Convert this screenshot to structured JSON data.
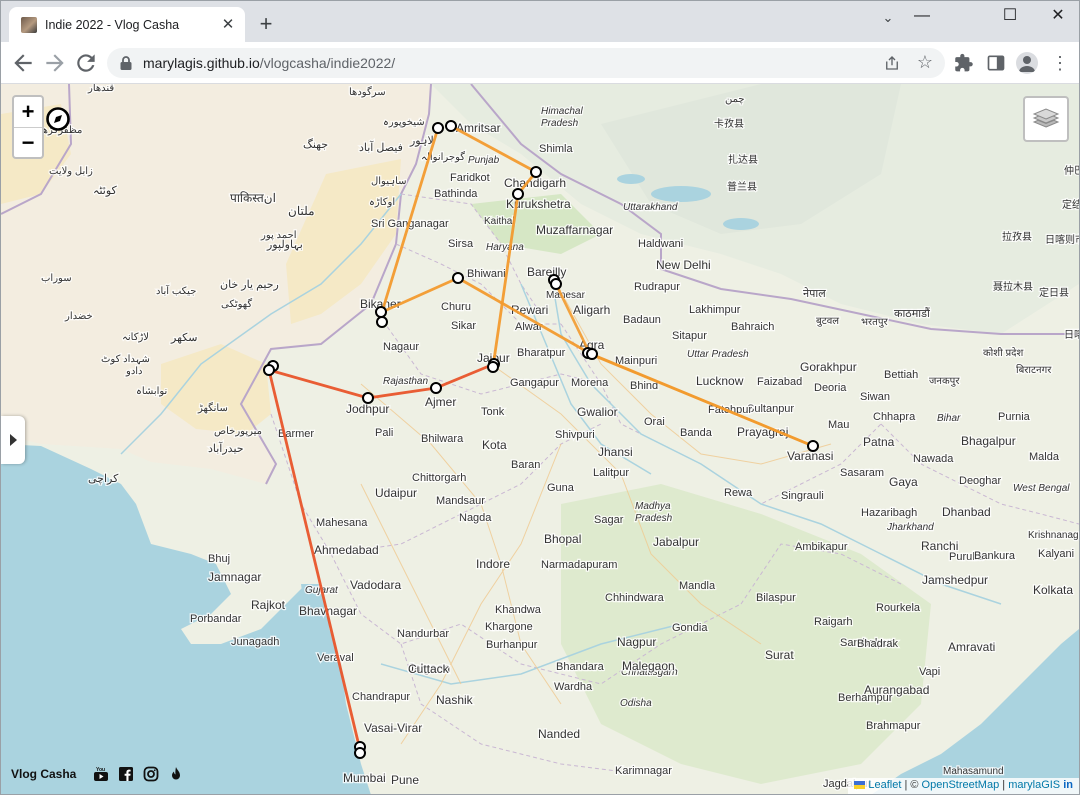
{
  "browser": {
    "tab_title": "Indie 2022 - Vlog Casha",
    "new_tab": "+",
    "close_tab": "✕",
    "win_min": "—",
    "win_max": "☐",
    "win_close": "✕",
    "url_host": "marylagis.github.io",
    "url_path": "/vlogcasha/indie2022/"
  },
  "map": {
    "zoom_in": "+",
    "zoom_out": "−",
    "brand": "Vlog Casha",
    "attribution": {
      "leaflet": "Leaflet",
      "sep1": " | © ",
      "osm": "OpenStreetMap",
      "sep2": " | ",
      "author": "marylaGIS",
      "in": "in"
    },
    "colors": {
      "route_orange": "#f29a2e",
      "route_red": "#e8542a",
      "water": "#aad3df",
      "land": "#eef0e4",
      "desert": "#f5e9c6",
      "forest": "#d6e7c5"
    },
    "labels": [
      {
        "text": "Amritsar",
        "size": 12
      },
      {
        "text": "Shimla",
        "size": 11
      },
      {
        "text": "Chandigarh",
        "size": 12
      },
      {
        "text": "Punjab",
        "size": 10,
        "italic": true
      },
      {
        "text": "Faridkot",
        "size": 11
      },
      {
        "text": "Bathinda",
        "size": 11
      },
      {
        "text": "Kurukshetra",
        "size": 12
      },
      {
        "text": "Kaithal",
        "size": 10
      },
      {
        "text": "Himachal",
        "size": 10,
        "italic": true
      },
      {
        "text": "Pradesh",
        "size": 10,
        "italic": true
      },
      {
        "text": "Uttarakhand",
        "size": 10,
        "italic": true
      },
      {
        "text": "Muzaffarnagar",
        "size": 12
      },
      {
        "text": "Sri Ganganagar",
        "size": 11
      },
      {
        "text": "Sirsa",
        "size": 11
      },
      {
        "text": "Haryana",
        "size": 10,
        "italic": true
      },
      {
        "text": "Haldwani",
        "size": 11
      },
      {
        "text": "Bhiwani",
        "size": 11
      },
      {
        "text": "New Delhi",
        "size": 12
      },
      {
        "text": "Rudrapur",
        "size": 11
      },
      {
        "text": "Bareilly",
        "size": 12
      },
      {
        "text": "Manesar",
        "size": 10
      },
      {
        "text": "Rewari",
        "size": 12
      },
      {
        "text": "Aligarh",
        "size": 12
      },
      {
        "text": "Lakhimpur",
        "size": 11
      },
      {
        "text": "Bikaner",
        "size": 12
      },
      {
        "text": "Churu",
        "size": 11
      },
      {
        "text": "Sikar",
        "size": 11
      },
      {
        "text": "Alwar",
        "size": 11
      },
      {
        "text": "Badaun",
        "size": 11
      },
      {
        "text": "Bahraich",
        "size": 11
      },
      {
        "text": "Sitapur",
        "size": 11
      },
      {
        "text": "Nagaur",
        "size": 11
      },
      {
        "text": "Jaipur",
        "size": 12
      },
      {
        "text": "Bharatpur",
        "size": 11
      },
      {
        "text": "Agra",
        "size": 12
      },
      {
        "text": "Mainpuri",
        "size": 11
      },
      {
        "text": "Uttar Pradesh",
        "size": 10,
        "italic": true
      },
      {
        "text": "Lucknow",
        "size": 12
      },
      {
        "text": "Faizabad",
        "size": 11
      },
      {
        "text": "Gorakhpur",
        "size": 12
      },
      {
        "text": "Rajasthan",
        "size": 10,
        "italic": true
      },
      {
        "text": "Gangapur",
        "size": 11
      },
      {
        "text": "Morena",
        "size": 11
      },
      {
        "text": "Bhind",
        "size": 11
      },
      {
        "text": "Jodhpur",
        "size": 12
      },
      {
        "text": "Ajmer",
        "size": 12
      },
      {
        "text": "Tonk",
        "size": 11
      },
      {
        "text": "Gwalior",
        "size": 12
      },
      {
        "text": "Sultanpur",
        "size": 11
      },
      {
        "text": "Fatehpur",
        "size": 11
      },
      {
        "text": "Prayagraj",
        "size": 12
      },
      {
        "text": "Mau",
        "size": 11
      },
      {
        "text": "Varanasi",
        "size": 12
      },
      {
        "text": "Deoria",
        "size": 11
      },
      {
        "text": "Siwan",
        "size": 11
      },
      {
        "text": "Bettiah",
        "size": 11
      },
      {
        "text": "Chhapra",
        "size": 11
      },
      {
        "text": "Patna",
        "size": 12
      },
      {
        "text": "Bhagalpur",
        "size": 12
      },
      {
        "text": "Purnia",
        "size": 11
      },
      {
        "text": "Bihar",
        "size": 10,
        "italic": true
      },
      {
        "text": "Barmer",
        "size": 11
      },
      {
        "text": "Pali",
        "size": 11
      },
      {
        "text": "Bhilwara",
        "size": 11
      },
      {
        "text": "Kota",
        "size": 12
      },
      {
        "text": "Shivpuri",
        "size": 11
      },
      {
        "text": "Orai",
        "size": 11
      },
      {
        "text": "Banda",
        "size": 11
      },
      {
        "text": "Jhansi",
        "size": 12
      },
      {
        "text": "Baran",
        "size": 11
      },
      {
        "text": "Lalitpur",
        "size": 11
      },
      {
        "text": "Sasaram",
        "size": 11
      },
      {
        "text": "Gaya",
        "size": 12
      },
      {
        "text": "Nawada",
        "size": 11
      },
      {
        "text": "Deoghar",
        "size": 11
      },
      {
        "text": "West Bengal",
        "size": 10,
        "italic": true
      },
      {
        "text": "Malda",
        "size": 11
      },
      {
        "text": "Chittorgarh",
        "size": 11
      },
      {
        "text": "Udaipur",
        "size": 12
      },
      {
        "text": "Mandsaur",
        "size": 11
      },
      {
        "text": "Guna",
        "size": 11
      },
      {
        "text": "Rewa",
        "size": 11
      },
      {
        "text": "Singrauli",
        "size": 11
      },
      {
        "text": "Madhya",
        "size": 10,
        "italic": true
      },
      {
        "text": "Pradesh",
        "size": 10,
        "italic": true
      },
      {
        "text": "Sagar",
        "size": 11
      },
      {
        "text": "Hazaribagh",
        "size": 11
      },
      {
        "text": "Jharkhand",
        "size": 10,
        "italic": true
      },
      {
        "text": "Dhanbad",
        "size": 12
      },
      {
        "text": "Krishnanagar",
        "size": 10
      },
      {
        "text": "Mahesana",
        "size": 11
      },
      {
        "text": "Ahmedabad",
        "size": 12
      },
      {
        "text": "Nagda",
        "size": 11
      },
      {
        "text": "Bhopal",
        "size": 12
      },
      {
        "text": "Jabalpur",
        "size": 12
      },
      {
        "text": "Ambikapur",
        "size": 11
      },
      {
        "text": "Ranchi",
        "size": 12
      },
      {
        "text": "Purulia",
        "size": 11
      },
      {
        "text": "Bankura",
        "size": 11
      },
      {
        "text": "Kalyani",
        "size": 11
      },
      {
        "text": "Bhuj",
        "size": 11
      },
      {
        "text": "Jamnagar",
        "size": 12
      },
      {
        "text": "Vadodara",
        "size": 12
      },
      {
        "text": "Indore",
        "size": 12
      },
      {
        "text": "Narmadapuram",
        "size": 11
      },
      {
        "text": "Mandla",
        "size": 11
      },
      {
        "text": "Jamshedpur",
        "size": 12
      },
      {
        "text": "Kolkata",
        "size": 12
      },
      {
        "text": "Rajkot",
        "size": 12
      },
      {
        "text": "Bhavnagar",
        "size": 12
      },
      {
        "text": "Chhindwara",
        "size": 11
      },
      {
        "text": "Bilaspur",
        "size": 11
      },
      {
        "text": "Rourkela",
        "size": 11
      },
      {
        "text": "Porbandar",
        "size": 11
      },
      {
        "text": "Gujarat",
        "size": 10,
        "italic": true
      },
      {
        "text": "Khandwa",
        "size": 11
      },
      {
        "text": "Khargone",
        "size": 11
      },
      {
        "text": "Gondia",
        "size": 11
      },
      {
        "text": "Junagadh",
        "size": 11
      },
      {
        "text": "Nandurbar",
        "size": 11
      },
      {
        "text": "Burhanpur",
        "size": 11
      },
      {
        "text": "Nagpur",
        "size": 12
      },
      {
        "text": "Raigarh",
        "size": 11
      },
      {
        "text": "Jalgaon",
        "size": 12
      },
      {
        "text": "Sambalpur",
        "size": 11
      },
      {
        "text": "Veraval",
        "size": 11
      },
      {
        "text": "Surat",
        "size": 12
      },
      {
        "text": "Bhandara",
        "size": 11
      },
      {
        "text": "Chhattisgarh",
        "size": 10,
        "italic": true
      },
      {
        "text": "Bhadrak",
        "size": 11
      },
      {
        "text": "Amravati",
        "size": 12
      },
      {
        "text": "Wardha",
        "size": 11
      },
      {
        "text": "Malegaon",
        "size": 12
      },
      {
        "text": "Cuttack",
        "size": 12
      },
      {
        "text": "Vapi",
        "size": 11
      },
      {
        "text": "Chandrapur",
        "size": 11
      },
      {
        "text": "Odisha",
        "size": 10,
        "italic": true
      },
      {
        "text": "Aurangabad",
        "size": 12
      },
      {
        "text": "Nashik",
        "size": 12
      },
      {
        "text": "Berhampur",
        "size": 11
      },
      {
        "text": "Brahmapur",
        "size": 11
      },
      {
        "text": "Vasai-Virar",
        "size": 12
      },
      {
        "text": "Nanded",
        "size": 12
      },
      {
        "text": "Mumbai",
        "size": 12
      },
      {
        "text": "Karimnagar",
        "size": 11
      },
      {
        "text": "Pune",
        "size": 12
      },
      {
        "text": "Jagdalpur",
        "size": 11
      },
      {
        "text": "Mahasamund",
        "size": 10
      },
      {
        "text": "नेपाल",
        "size": 11
      },
      {
        "text": "काठमाडौं",
        "size": 11
      },
      {
        "text": "बुटवल",
        "size": 10
      },
      {
        "text": "भरतपुर",
        "size": 10
      },
      {
        "text": "कोशी प्रदेश",
        "size": 10
      },
      {
        "text": "बिराटनगर",
        "size": 10
      },
      {
        "text": "जनकपुर",
        "size": 10
      },
      {
        "text": "पाकिस्तان",
        "size": 12
      },
      {
        "text": "ملتان",
        "size": 12
      },
      {
        "text": "لاہور",
        "size": 11
      },
      {
        "text": "گوجرانوالہ",
        "size": 10
      },
      {
        "text": "فیصل آباد",
        "size": 11
      },
      {
        "text": "جھنگ",
        "size": 11
      },
      {
        "text": "کوئٹہ",
        "size": 11
      },
      {
        "text": "بہاولپور",
        "size": 11
      },
      {
        "text": "رحیم یار خان",
        "size": 11
      },
      {
        "text": "سکھر",
        "size": 11
      },
      {
        "text": "لاڑکانہ",
        "size": 10
      },
      {
        "text": "حیدرآباد",
        "size": 11
      },
      {
        "text": "کراچی",
        "size": 11
      },
      {
        "text": "شیخوپورہ",
        "size": 10
      },
      {
        "text": "سرگودھا",
        "size": 10
      },
      {
        "text": "ساہیوال",
        "size": 10
      },
      {
        "text": "اوکاڑہ",
        "size": 10
      },
      {
        "text": "سوراب",
        "size": 10
      },
      {
        "text": "خضدار",
        "size": 10
      },
      {
        "text": "دادو",
        "size": 10
      },
      {
        "text": "میرپورخاص",
        "size": 10
      },
      {
        "text": "سانگھڑ",
        "size": 10
      },
      {
        "text": "نوابشاہ",
        "size": 10
      },
      {
        "text": "شہداد کوٹ",
        "size": 10
      },
      {
        "text": "جیکب آباد",
        "size": 10
      },
      {
        "text": "گھوٹکی",
        "size": 10
      },
      {
        "text": "احمد پور",
        "size": 10
      },
      {
        "text": "مظفرگڑھ",
        "size": 10
      },
      {
        "text": "قندھار",
        "size": 10
      },
      {
        "text": "زابل ولایت",
        "size": 10
      },
      {
        "text": "چمن",
        "size": 10
      },
      {
        "text": "卡孜县",
        "size": 10
      },
      {
        "text": "扎达县",
        "size": 10
      },
      {
        "text": "普兰县",
        "size": 10
      },
      {
        "text": "仲巴县",
        "size": 10
      },
      {
        "text": "日喀则市",
        "size": 10
      },
      {
        "text": "拉孜县",
        "size": 10
      },
      {
        "text": "聂拉木县",
        "size": 10
      },
      {
        "text": "定日县",
        "size": 10
      },
      {
        "text": "定结县",
        "size": 10
      },
      {
        "text": "日喀则市",
        "size": 10
      },
      {
        "text": "仲巴县",
        "size": 10
      }
    ]
  }
}
